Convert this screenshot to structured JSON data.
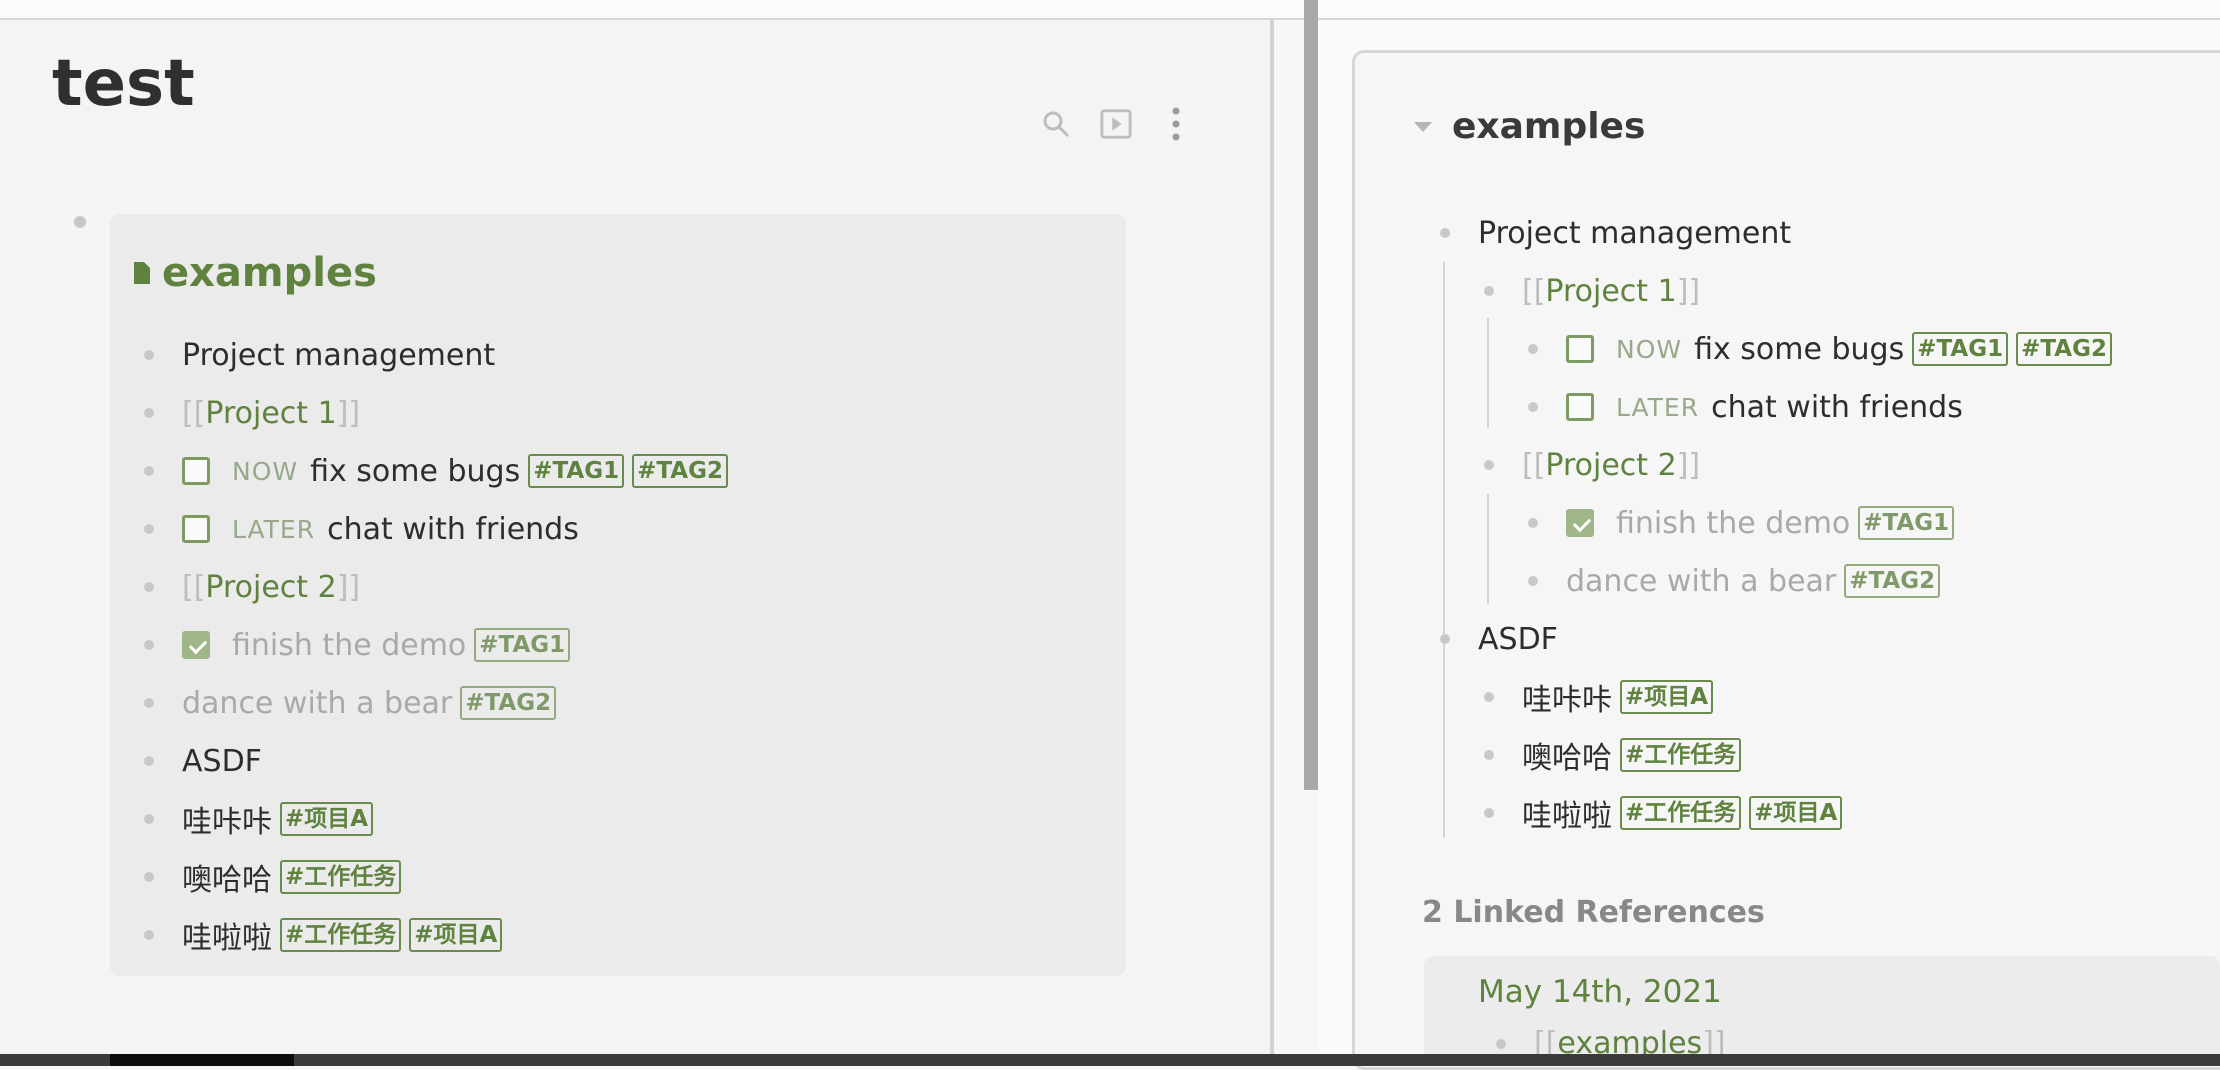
{
  "page": {
    "title": "test"
  },
  "embed": {
    "title": "examples",
    "items": [
      {
        "text": "Project management"
      },
      {
        "pre": "[[",
        "link": "Project 1",
        "post": "]]"
      },
      {
        "marker": "NOW",
        "text": "fix some bugs",
        "tags": [
          "#TAG1",
          "#TAG2"
        ]
      },
      {
        "marker": "LATER",
        "text": "chat with friends"
      },
      {
        "pre": "[[",
        "link": "Project 2",
        "post": "]]"
      },
      {
        "text": "finish the demo",
        "tags": [
          "#TAG1"
        ]
      },
      {
        "text": "dance with a bear",
        "tags": [
          "#TAG2"
        ]
      },
      {
        "text": "ASDF"
      },
      {
        "text": "哇咔咔",
        "tags": [
          "#项目A"
        ]
      },
      {
        "text": "噢哈哈",
        "tags": [
          "#工作任务"
        ]
      },
      {
        "text": "哇啦啦",
        "tags": [
          "#工作任务",
          "#项目A"
        ]
      }
    ]
  },
  "sidebar_page": {
    "title": "examples",
    "items": [
      {
        "text": "Project management"
      },
      {
        "pre": "[[",
        "link": "Project 1",
        "post": "]]"
      },
      {
        "marker": "NOW",
        "text": "fix some bugs",
        "tags": [
          "#TAG1",
          "#TAG2"
        ]
      },
      {
        "marker": "LATER",
        "text": "chat with friends"
      },
      {
        "pre": "[[",
        "link": "Project 2",
        "post": "]]"
      },
      {
        "text": "finish the demo",
        "tags": [
          "#TAG1"
        ]
      },
      {
        "text": "dance with a bear",
        "tags": [
          "#TAG2"
        ]
      },
      {
        "text": "ASDF"
      },
      {
        "text": "哇咔咔",
        "tags": [
          "#项目A"
        ]
      },
      {
        "text": "噢哈哈",
        "tags": [
          "#工作任务"
        ]
      },
      {
        "text": "哇啦啦",
        "tags": [
          "#工作任务",
          "#项目A"
        ]
      }
    ],
    "linked_references": {
      "heading": "2 Linked References",
      "date": "May 14th, 2021",
      "item": {
        "pre": "[[",
        "link": "examples",
        "post": "]]"
      }
    }
  },
  "colors": {
    "accent": "#5f823f",
    "tag_border": "#6a8c4a",
    "checkbox": "#7d9a62",
    "done_text": "#a9a9a9"
  },
  "icons": [
    "search-icon",
    "presentation-icon",
    "more-vertical-icon",
    "page-icon",
    "collapse-caret-icon"
  ]
}
